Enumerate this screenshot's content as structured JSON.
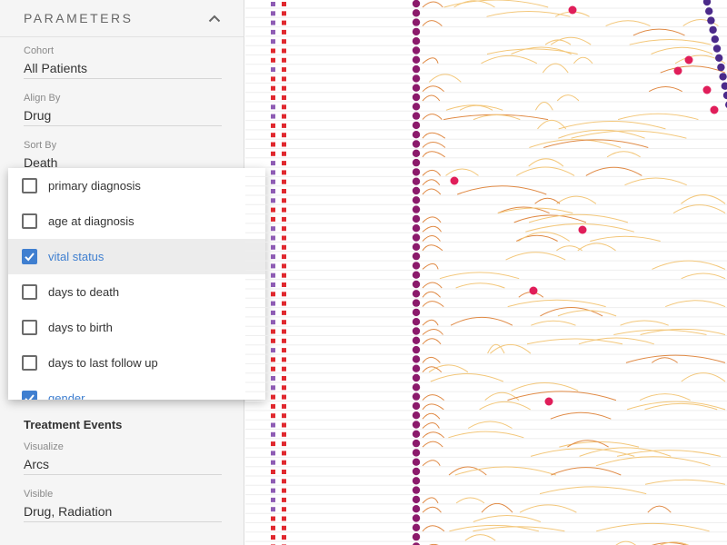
{
  "panel": {
    "title": "PARAMETERS",
    "fields": [
      {
        "label": "Cohort",
        "value": "All Patients"
      },
      {
        "label": "Align By",
        "value": "Drug"
      },
      {
        "label": "Sort By",
        "value": "Death"
      }
    ],
    "treatment": {
      "heading": "Treatment Events",
      "fields": [
        {
          "label": "Visualize",
          "value": "Arcs"
        },
        {
          "label": "Visible",
          "value": "Drug, Radiation"
        }
      ]
    }
  },
  "dropdown": {
    "items": [
      {
        "label": "primary diagnosis",
        "checked": false
      },
      {
        "label": "age at diagnosis",
        "checked": false
      },
      {
        "label": "vital status",
        "checked": true
      },
      {
        "label": "days to death",
        "checked": false
      },
      {
        "label": "days to birth",
        "checked": false
      },
      {
        "label": "days to last follow up",
        "checked": false
      },
      {
        "label": "gender",
        "checked": true
      }
    ]
  },
  "colors": {
    "accent": "#3f7fd0",
    "attr_red": "#e0282e",
    "attr_purple": "#8e5cb4",
    "align_dot": "#8b1a6b",
    "event_dot": "#e01e5a",
    "death_dot": "#4b2a8a",
    "arc_light": "#f3c77a",
    "arc_dark": "#e08a45"
  }
}
